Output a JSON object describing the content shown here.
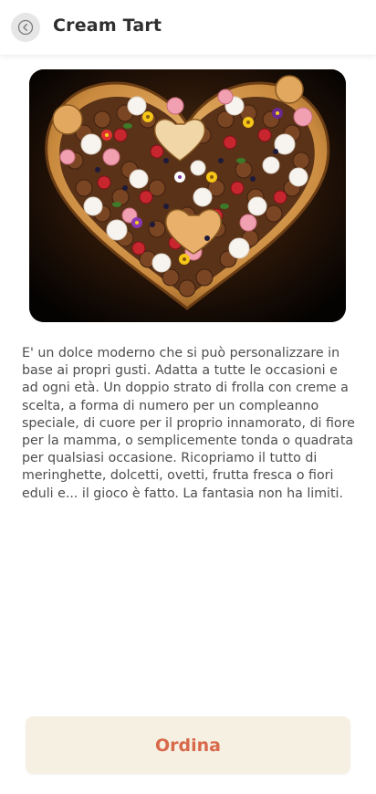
{
  "header": {
    "title": "Cream Tart",
    "back_icon": "back-arrow-circle-icon"
  },
  "product": {
    "image_alt": "Heart-shaped cream tart decorated with meringues, flowers, berries and cookies",
    "description": "E' un dolce moderno che si può personalizzare in base ai propri gusti. Adatta a tutte le occasioni e ad ogni età.  Un doppio strato di frolla con creme a scelta, a forma di numero per un compleanno speciale, di cuore per il proprio innamorato, di fiore per la mamma, o semplicemente tonda o quadrata per qualsiasi occasione. Ricopriamo il tutto di meringhette, dolcetti, ovetti, frutta fresca o fiori eduli e... il gioco è fatto. La fantasia non ha limiti."
  },
  "actions": {
    "order_label": "Ordina"
  },
  "colors": {
    "accent": "#d8694a",
    "button_bg": "#f6f0e2",
    "back_bg": "#e6e6e6"
  }
}
